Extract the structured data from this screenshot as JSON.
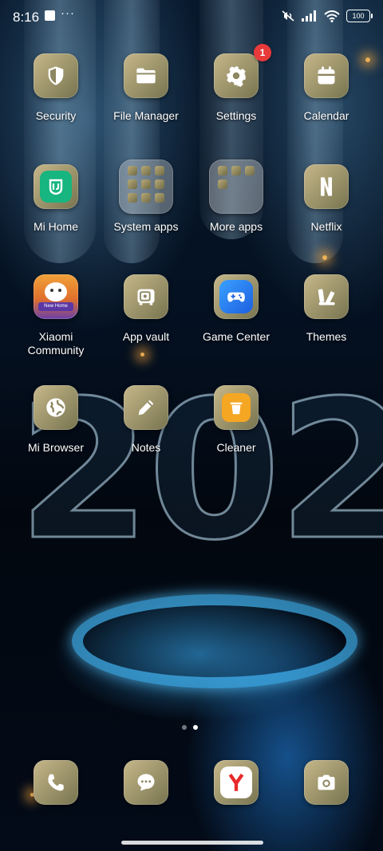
{
  "status_bar": {
    "time": "8:16",
    "more": "···",
    "battery": "100",
    "icons": [
      "image-notification-icon",
      "mute-icon",
      "signal-icon",
      "wifi-icon",
      "battery-icon"
    ]
  },
  "apps": [
    {
      "label": "Security",
      "icon": "shield-icon"
    },
    {
      "label": "File Manager",
      "icon": "folder-icon"
    },
    {
      "label": "Settings",
      "icon": "gear-icon",
      "badge": "1"
    },
    {
      "label": "Calendar",
      "icon": "calendar-icon"
    },
    {
      "label": "Mi Home",
      "icon": "mi-home-icon"
    },
    {
      "label": "System apps",
      "icon": "app-folder"
    },
    {
      "label": "More apps",
      "icon": "app-folder"
    },
    {
      "label": "Netflix",
      "icon": "netflix-icon"
    },
    {
      "label": "Xiaomi Community",
      "icon": "community-icon",
      "icon_text": "New Home"
    },
    {
      "label": "App vault",
      "icon": "vault-icon"
    },
    {
      "label": "Game Center",
      "icon": "gamepad-icon"
    },
    {
      "label": "Themes",
      "icon": "themes-icon"
    },
    {
      "label": "Mi Browser",
      "icon": "globe-icon"
    },
    {
      "label": "Notes",
      "icon": "pencil-icon"
    },
    {
      "label": "Cleaner",
      "icon": "trash-icon"
    }
  ],
  "dock": [
    {
      "name": "Phone",
      "icon": "phone-icon"
    },
    {
      "name": "Messages",
      "icon": "message-icon"
    },
    {
      "name": "Browser",
      "icon": "yandex-browser-icon"
    },
    {
      "name": "Camera",
      "icon": "camera-icon"
    }
  ],
  "pages": {
    "count": 2,
    "current": 2
  },
  "colors": {
    "tile_light": "#c6b78a",
    "tile_dark": "#77744f",
    "badge": "#e83a3a",
    "accent_red": "#e82a2a"
  }
}
